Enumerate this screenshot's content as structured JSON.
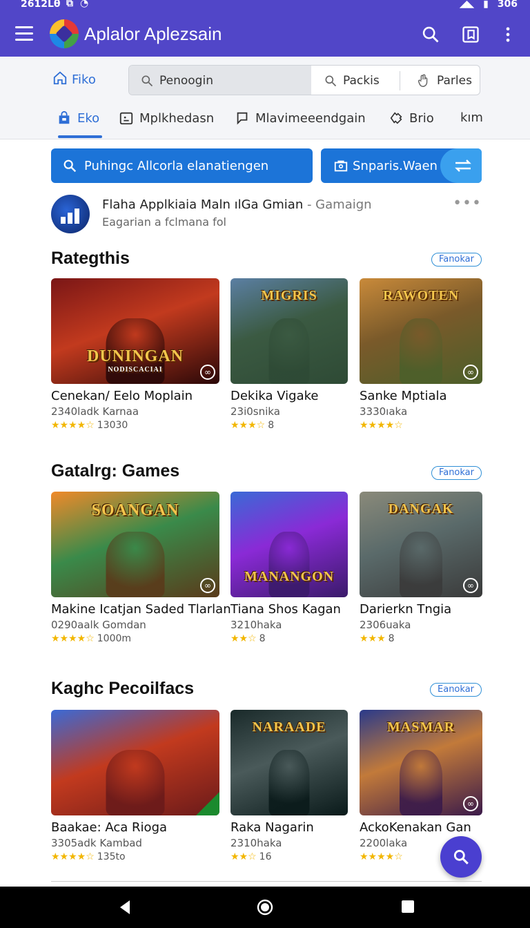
{
  "status": {
    "time": "2612Lθ",
    "battery": "306"
  },
  "appbar": {
    "title": "Aplalor Aplezsain"
  },
  "search": {
    "home_label": "Fiko",
    "segments": [
      "Penoogin",
      "Packis",
      "Parles"
    ]
  },
  "tabs": [
    "Eko",
    "Mplkhedasn",
    "Mlavimeeendgain",
    "Brio",
    "kım"
  ],
  "actions": {
    "search_button": "Puhingc Allcorla elanatiengen",
    "secondary_button": "Snparis.Waen"
  },
  "promo": {
    "title": "Flaha Applkiaia Maln ılGa Gmian",
    "title_suffix": "- Gamaign",
    "subtitle": "Eagarian a fclmana fol"
  },
  "sections": [
    {
      "title": "Rategthis",
      "more": "Fanokar",
      "cards": [
        {
          "thumb_title": "DUNINGAN",
          "thumb_sub": "NODISCACIAI",
          "name": "Cenekan/ Eelo Moplain",
          "meta": "2340ladk Karnaa",
          "stars": "★★★★☆",
          "count": "13030",
          "colors": [
            "#7a1616",
            "#2a0808",
            "#c23a1e"
          ]
        },
        {
          "thumb_title": "MIGRIS",
          "thumb_sub": "",
          "name": "Dekika Vigake",
          "meta": "23i0snika",
          "stars": "★★★☆",
          "count": "8",
          "colors": [
            "#5b7fa3",
            "#2e4a35",
            "#3b5a42"
          ]
        },
        {
          "thumb_title": "RAWOTEN",
          "thumb_sub": "",
          "name": "Sanke Mptiala",
          "meta": "3330ıaka",
          "stars": "★★★★☆",
          "count": "",
          "colors": [
            "#c98a3a",
            "#4c5f2a",
            "#7a5a2a"
          ]
        }
      ]
    },
    {
      "title": "Gatalrg: Games",
      "more": "Fanokar",
      "cards": [
        {
          "thumb_title": "SOANGAN",
          "thumb_sub": "",
          "name": "Makine Icatjan Saded Tlarlan",
          "meta": "0290aalk Gomdan",
          "stars": "★★★★☆",
          "count": "1000m",
          "colors": [
            "#f08a2a",
            "#5a3a1a",
            "#3a8a4a"
          ]
        },
        {
          "thumb_title": "MANANGON",
          "thumb_sub": "",
          "name": "Tiana Shos Kagan",
          "meta": "3210haka",
          "stars": "★★☆",
          "count": "8",
          "colors": [
            "#3a6ad6",
            "#3a1a6a",
            "#8a2ad6"
          ]
        },
        {
          "thumb_title": "DANGAK",
          "thumb_sub": "",
          "name": "Darierkn Tngia",
          "meta": "2306uaka",
          "stars": "★★★",
          "count": "8",
          "colors": [
            "#8a8a7a",
            "#3a3a3a",
            "#5a6a6a"
          ]
        }
      ]
    },
    {
      "title": "Kaghc Pecoilfacs",
      "more": "Eanokar",
      "cards": [
        {
          "thumb_title": "",
          "thumb_sub": "",
          "name": "Baakae: Aca Rioga",
          "meta": "3305adk Kambad",
          "stars": "★★★★☆",
          "count": "135to",
          "colors": [
            "#3a6ad6",
            "#6a1a1a",
            "#c23a1e"
          ]
        },
        {
          "thumb_title": "NARAADE",
          "thumb_sub": "",
          "name": "Raka Nagarin",
          "meta": "2310haka",
          "stars": "★★☆",
          "count": "16",
          "colors": [
            "#1a2a2a",
            "#0a1a1a",
            "#4a5a5a"
          ]
        },
        {
          "thumb_title": "MASMAR",
          "thumb_sub": "",
          "name": "AckoKenakan Gan",
          "meta": "2200laka",
          "stars": "★★★★☆",
          "count": "",
          "colors": [
            "#2a3a8a",
            "#3a1a4a",
            "#c27a3a"
          ]
        }
      ]
    }
  ]
}
